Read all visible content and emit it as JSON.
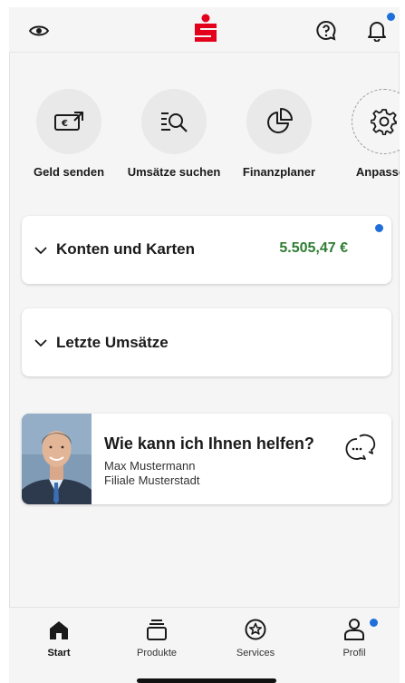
{
  "colors": {
    "brand": "#e2001a",
    "accent": "#1e6fd9",
    "positive": "#2e7d32"
  },
  "header": {
    "left_icon": "eye-icon",
    "logo": "sparkasse-logo",
    "help_icon": "help-chat-icon",
    "notification_icon": "bell-icon"
  },
  "quick_actions": [
    {
      "label": "Geld senden",
      "icon": "money-transfer-icon"
    },
    {
      "label": "Umsätze suchen",
      "icon": "search-transactions-icon"
    },
    {
      "label": "Finanzplaner",
      "icon": "pie-chart-icon"
    },
    {
      "label": "Anpassen",
      "icon": "gear-icon"
    }
  ],
  "accounts_card": {
    "title": "Konten und Karten",
    "amount": "5.505,47 €"
  },
  "transactions_card": {
    "title": "Letzte Umsätze"
  },
  "advisor_card": {
    "title": "Wie kann ich Ihnen helfen?",
    "name": "Max Mustermann",
    "branch": "Filiale Musterstadt",
    "icon": "chat-bubbles-icon"
  },
  "bottom_nav": [
    {
      "label": "Start",
      "icon": "home-icon"
    },
    {
      "label": "Produkte",
      "icon": "products-stack-icon"
    },
    {
      "label": "Services",
      "icon": "services-star-icon"
    },
    {
      "label": "Profil",
      "icon": "person-icon"
    }
  ]
}
